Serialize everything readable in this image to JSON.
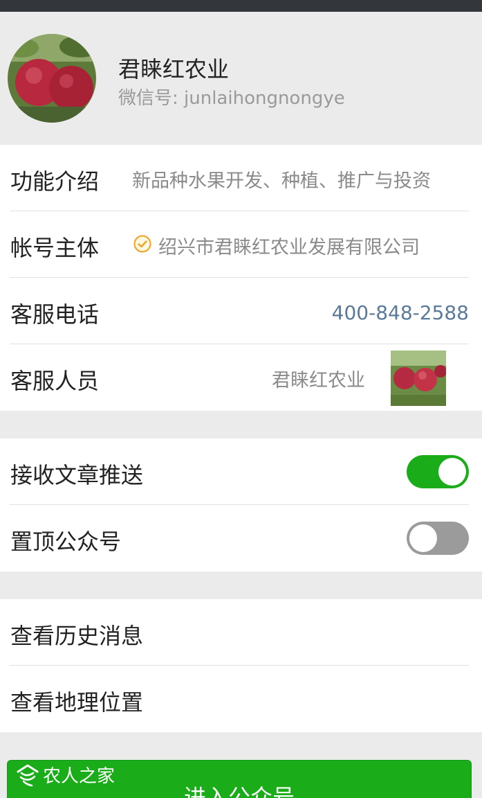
{
  "profile": {
    "name": "君睐红农业",
    "wechat_id": "微信号: junlaihongnongye"
  },
  "info": {
    "intro_label": "功能介绍",
    "intro_value": "新品种水果开发、种植、推广与投资",
    "entity_label": "帐号主体",
    "entity_value": "绍兴市君睐红农业发展有限公司",
    "phone_label": "客服电话",
    "phone_value": "400-848-2588",
    "agent_label": "客服人员",
    "agent_value": "君睐红农业"
  },
  "settings": {
    "push_label": "接收文章推送",
    "push_on": true,
    "pin_label": "置顶公众号",
    "pin_on": false
  },
  "links": {
    "history_label": "查看历史消息",
    "location_label": "查看地理位置"
  },
  "action": {
    "enter_label": "进入公众号"
  },
  "watermark": {
    "text": "农人之家"
  },
  "colors": {
    "accent": "#1aad19",
    "status_bar": "#33363b",
    "phone_link": "#5a7a99"
  }
}
